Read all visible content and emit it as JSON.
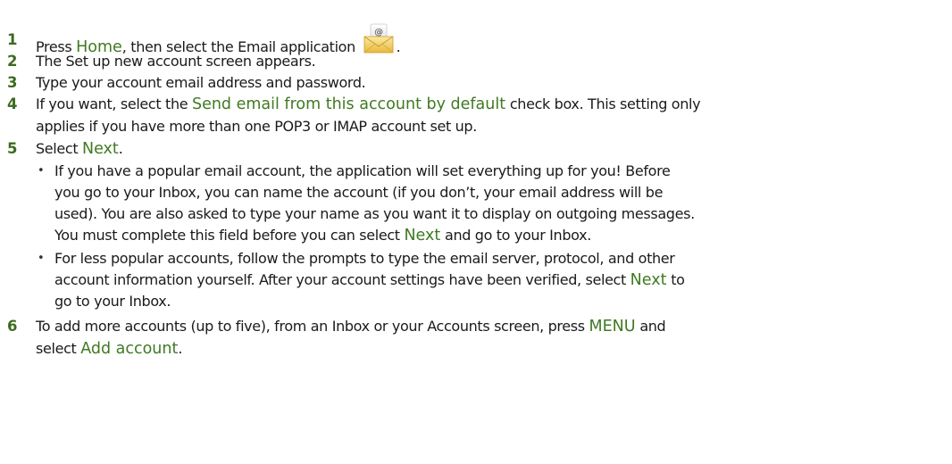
{
  "steps": [
    {
      "num": "1",
      "pre": "Press ",
      "home": "Home",
      "post": ", then select the Email application ",
      "end": "."
    },
    {
      "num": "2",
      "text": "The Set up new account screen appears."
    },
    {
      "num": "3",
      "text": "Type your account email address and password."
    },
    {
      "num": "4",
      "pre": "If you want, select the ",
      "highlight": "Send email from this account by default",
      "post": " check box. This setting only",
      "line2": "applies if you have more than one POP3 or IMAP account set up."
    },
    {
      "num": "5",
      "pre": "Select ",
      "next": "Next",
      "end": "."
    },
    {
      "num": "6",
      "pre": "To add more accounts (up to five), from an Inbox or your Accounts screen, press ",
      "menu": "MENU",
      "post": " and",
      "line2_pre": "select ",
      "add_account": "Add account",
      "end": "."
    }
  ],
  "bullets": [
    {
      "line1": "If you have a popular email account, the application will set everything up for you! Before",
      "line2": "you go to your Inbox, you can name the account (if you don’t, your email address will be",
      "line3": "used). You are also asked to type your name as you want it to display on outgoing messages.",
      "line4_pre": "You must complete this field before you can select ",
      "next": "Next",
      "line4_post": " and go to your Inbox."
    },
    {
      "line1": "For less popular accounts, follow the prompts to type the email server, protocol, and other",
      "line2_pre": "account information yourself. After your account settings have been verified, select ",
      "next": "Next",
      "line2_post": " to",
      "line3": "go to your Inbox."
    }
  ],
  "bullet_char": "•",
  "email_icon": {
    "name": "email-envelope-icon",
    "at_symbol": "@"
  },
  "colors": {
    "step_number": "#3d6b1f",
    "highlight": "#3f7a22",
    "text": "#1a1a1a"
  }
}
